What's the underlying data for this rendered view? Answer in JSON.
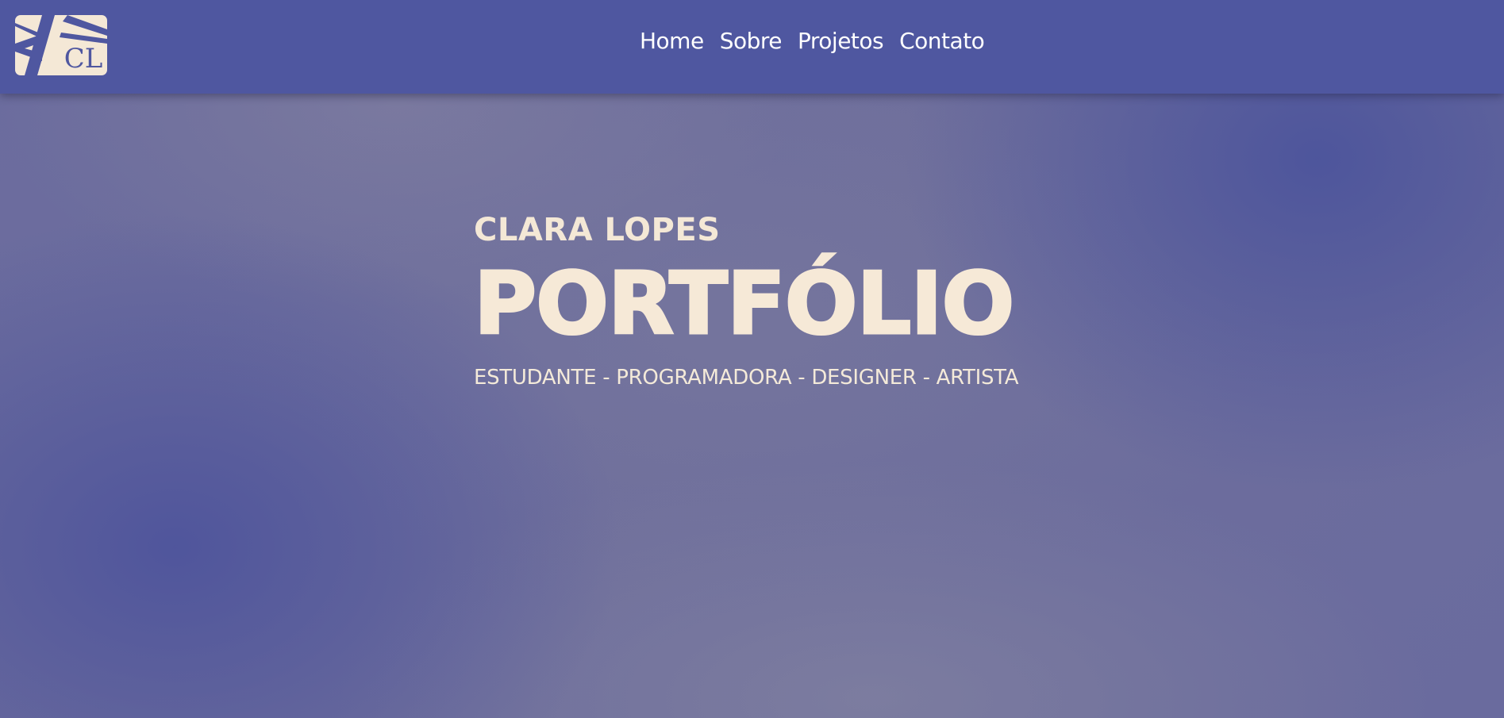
{
  "header": {
    "logo_text": "CL",
    "nav": [
      {
        "label": "Home"
      },
      {
        "label": "Sobre"
      },
      {
        "label": "Projetos"
      },
      {
        "label": "Contato"
      }
    ]
  },
  "hero": {
    "name": "CLARA LOPES",
    "title": "PORTFÓLIO",
    "subtitle": "ESTUDANTE - PROGRAMADORA - DESIGNER - ARTISTA"
  },
  "colors": {
    "header_bg": "#4f57a0",
    "accent_cream": "#f4e8d6",
    "nav_text": "#ffffff"
  }
}
